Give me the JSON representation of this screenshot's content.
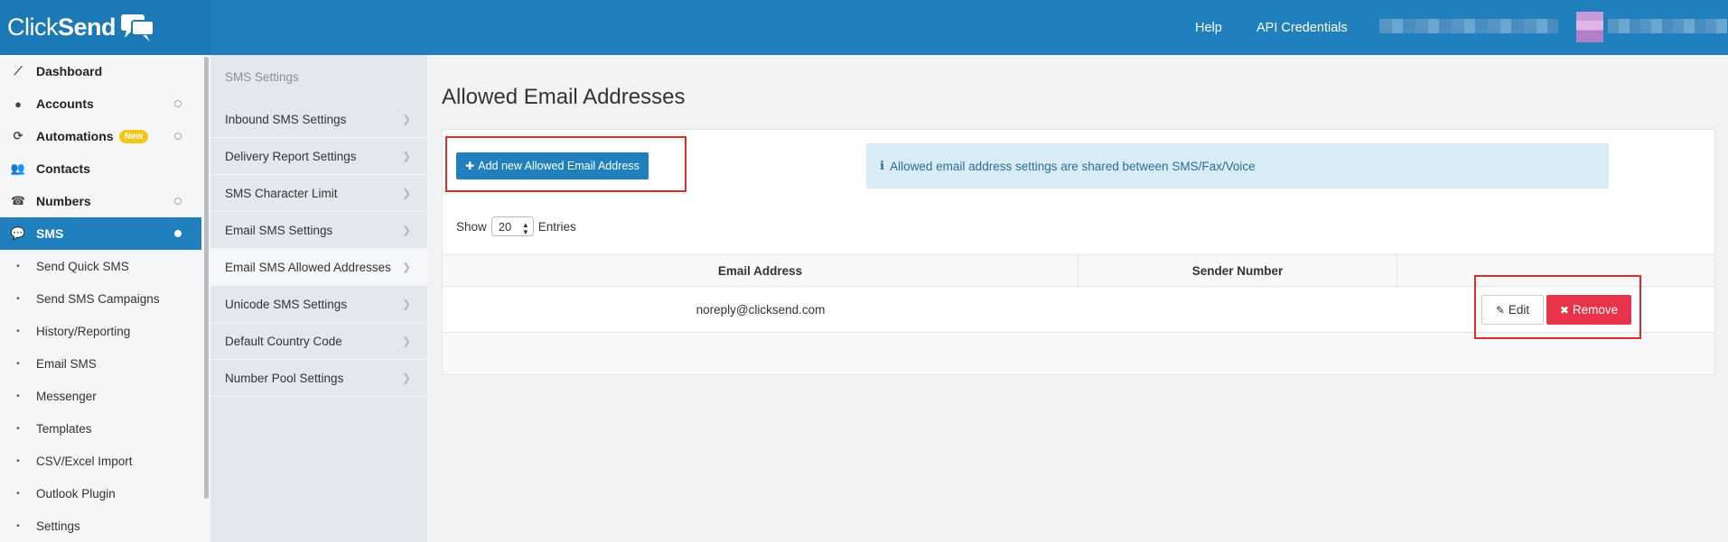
{
  "brand": {
    "name_light": "Click",
    "name_bold": "Send"
  },
  "header": {
    "help": "Help",
    "api": "API Credentials"
  },
  "sidebar": {
    "items": [
      {
        "label": "Dashboard",
        "icon": "chart-icon"
      },
      {
        "label": "Accounts",
        "icon": "user-icon"
      },
      {
        "label": "Automations",
        "icon": "refresh-icon",
        "badge": "New"
      },
      {
        "label": "Contacts",
        "icon": "users-icon"
      },
      {
        "label": "Numbers",
        "icon": "phone-icon"
      },
      {
        "label": "SMS",
        "icon": "chat-icon",
        "active": true
      }
    ],
    "sub_items": [
      "Send Quick SMS",
      "Send SMS Campaigns",
      "History/Reporting",
      "Email SMS",
      "Messenger",
      "Templates",
      "CSV/Excel Import",
      "Outlook Plugin",
      "Settings"
    ]
  },
  "subnav": {
    "title": "SMS Settings",
    "items": [
      "Inbound SMS Settings",
      "Delivery Report Settings",
      "SMS Character Limit",
      "Email SMS Settings",
      "Email SMS Allowed Addresses",
      "Unicode SMS Settings",
      "Default Country Code",
      "Number Pool Settings"
    ]
  },
  "main": {
    "title": "Allowed Email Addresses",
    "add_button": "Add new Allowed Email Address",
    "info": "Allowed email address settings are shared between SMS/Fax/Voice",
    "show_label": "Show",
    "page_size": "20",
    "entries_label": "Entries",
    "table": {
      "headers": [
        "Email Address",
        "Sender Number",
        ""
      ],
      "rows": [
        {
          "email": "noreply@clicksend.com",
          "sender": ""
        }
      ]
    },
    "edit_label": "Edit",
    "remove_label": "Remove"
  },
  "colors": {
    "brand_blue": "#2080bd",
    "danger": "#e8344a",
    "highlight": "#e02b2b"
  }
}
